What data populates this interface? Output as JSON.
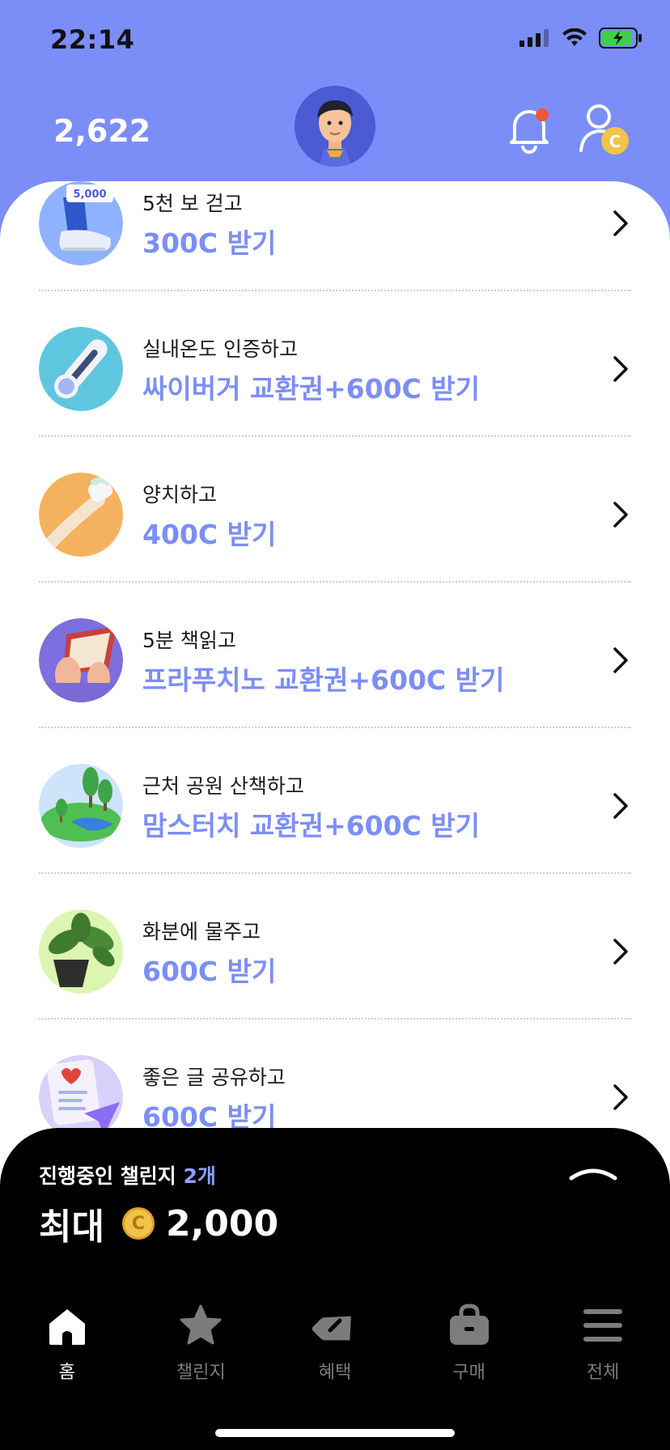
{
  "status": {
    "time": "22:14"
  },
  "header": {
    "points": "2,622",
    "coin_symbol": "C"
  },
  "items": [
    {
      "sub": "5천 보 걷고",
      "main": "300C 받기",
      "badge": "5,000",
      "icon": "sneaker-icon"
    },
    {
      "sub": "실내온도 인증하고",
      "main": "싸이버거 교환권+600C 받기",
      "icon": "thermometer-icon"
    },
    {
      "sub": "양치하고",
      "main": "400C 받기",
      "icon": "toothbrush-icon"
    },
    {
      "sub": "5분 책읽고",
      "main": "프라푸치노 교환권+600C 받기",
      "icon": "book-icon"
    },
    {
      "sub": "근처 공원 산책하고",
      "main": "맘스터치 교환권+600C 받기",
      "icon": "park-icon"
    },
    {
      "sub": "화분에 물주고",
      "main": "600C 받기",
      "icon": "plant-icon"
    },
    {
      "sub": "좋은 글 공유하고",
      "main": "600C 받기",
      "icon": "share-letter-icon"
    }
  ],
  "challenge": {
    "label": "진행중인 챌린지",
    "count": "2개",
    "max_label": "최대",
    "coin_symbol": "C",
    "max_value": "2,000"
  },
  "tabs": [
    {
      "label": "홈",
      "icon": "home-icon",
      "active": true
    },
    {
      "label": "챌린지",
      "icon": "star-icon",
      "active": false
    },
    {
      "label": "혜택",
      "icon": "tag-icon",
      "active": false
    },
    {
      "label": "구매",
      "icon": "bag-icon",
      "active": false
    },
    {
      "label": "전체",
      "icon": "menu-icon",
      "active": false
    }
  ],
  "colors": {
    "brand": "#7b8ef7",
    "sheet": "#000000"
  }
}
